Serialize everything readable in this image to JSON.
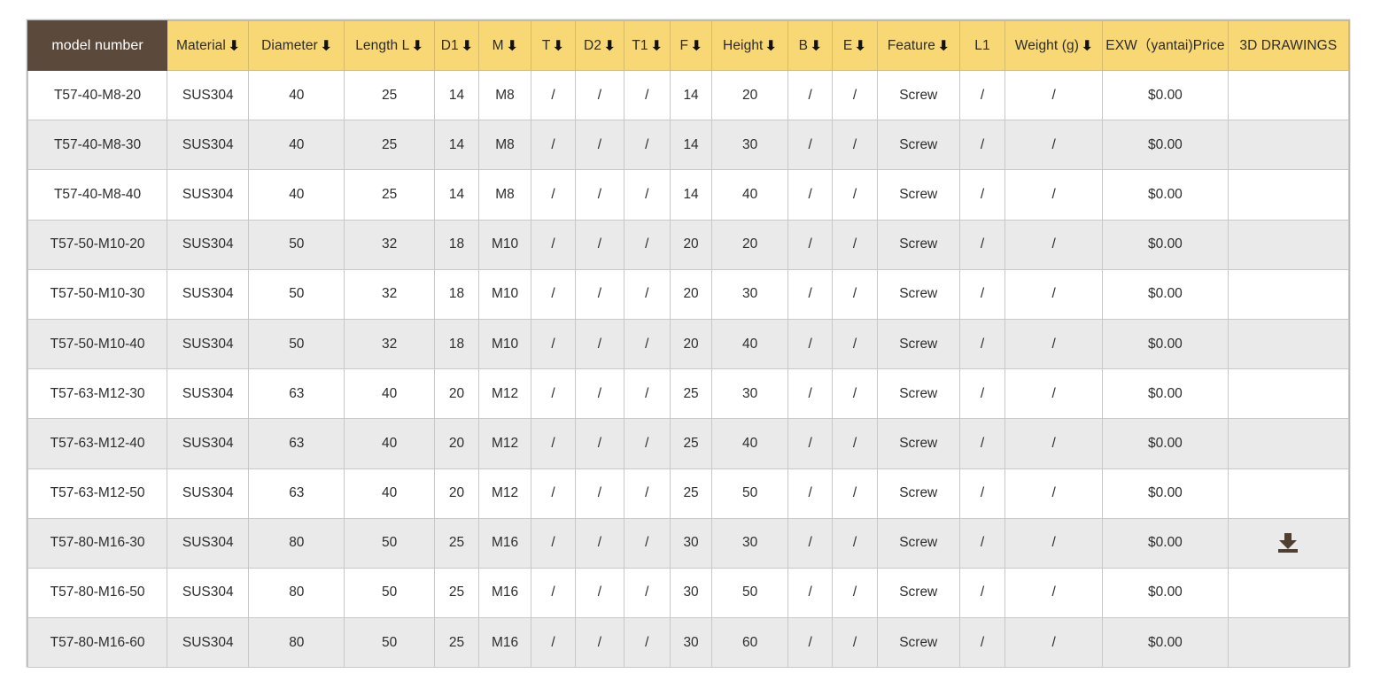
{
  "table": {
    "accent_header_bg": "#f8d775",
    "first_header_bg": "#5b4a3b",
    "stripe_bg": "#eaeaea",
    "icon_color": "#4e3f31",
    "sort_arrow_glyph": "⬇",
    "columns": [
      {
        "label": "model number",
        "sortable": false
      },
      {
        "label": "Material",
        "sortable": true
      },
      {
        "label": "Diameter",
        "sortable": true
      },
      {
        "label": "Length L",
        "sortable": true
      },
      {
        "label": "D1",
        "sortable": true
      },
      {
        "label": "M",
        "sortable": true
      },
      {
        "label": "T",
        "sortable": true
      },
      {
        "label": "D2",
        "sortable": true
      },
      {
        "label": "T1",
        "sortable": true
      },
      {
        "label": "F",
        "sortable": true
      },
      {
        "label": "Height",
        "sortable": true
      },
      {
        "label": "B",
        "sortable": true
      },
      {
        "label": "E",
        "sortable": true
      },
      {
        "label": "Feature",
        "sortable": true
      },
      {
        "label": "L1",
        "sortable": false
      },
      {
        "label": "Weight (g)",
        "sortable": true
      },
      {
        "label": "EXW（yantai)Price",
        "sortable": false
      },
      {
        "label": "3D DRAWINGS",
        "sortable": false
      }
    ],
    "rows": [
      {
        "cells": [
          "T57-40-M8-20",
          "SUS304",
          "40",
          "25",
          "14",
          "M8",
          "/",
          "/",
          "/",
          "14",
          "20",
          "/",
          "/",
          "Screw",
          "/",
          "/",
          "$0.00"
        ],
        "drawing": false
      },
      {
        "cells": [
          "T57-40-M8-30",
          "SUS304",
          "40",
          "25",
          "14",
          "M8",
          "/",
          "/",
          "/",
          "14",
          "30",
          "/",
          "/",
          "Screw",
          "/",
          "/",
          "$0.00"
        ],
        "drawing": false
      },
      {
        "cells": [
          "T57-40-M8-40",
          "SUS304",
          "40",
          "25",
          "14",
          "M8",
          "/",
          "/",
          "/",
          "14",
          "40",
          "/",
          "/",
          "Screw",
          "/",
          "/",
          "$0.00"
        ],
        "drawing": false
      },
      {
        "cells": [
          "T57-50-M10-20",
          "SUS304",
          "50",
          "32",
          "18",
          "M10",
          "/",
          "/",
          "/",
          "20",
          "20",
          "/",
          "/",
          "Screw",
          "/",
          "/",
          "$0.00"
        ],
        "drawing": false
      },
      {
        "cells": [
          "T57-50-M10-30",
          "SUS304",
          "50",
          "32",
          "18",
          "M10",
          "/",
          "/",
          "/",
          "20",
          "30",
          "/",
          "/",
          "Screw",
          "/",
          "/",
          "$0.00"
        ],
        "drawing": false
      },
      {
        "cells": [
          "T57-50-M10-40",
          "SUS304",
          "50",
          "32",
          "18",
          "M10",
          "/",
          "/",
          "/",
          "20",
          "40",
          "/",
          "/",
          "Screw",
          "/",
          "/",
          "$0.00"
        ],
        "drawing": false
      },
      {
        "cells": [
          "T57-63-M12-30",
          "SUS304",
          "63",
          "40",
          "20",
          "M12",
          "/",
          "/",
          "/",
          "25",
          "30",
          "/",
          "/",
          "Screw",
          "/",
          "/",
          "$0.00"
        ],
        "drawing": false
      },
      {
        "cells": [
          "T57-63-M12-40",
          "SUS304",
          "63",
          "40",
          "20",
          "M12",
          "/",
          "/",
          "/",
          "25",
          "40",
          "/",
          "/",
          "Screw",
          "/",
          "/",
          "$0.00"
        ],
        "drawing": false
      },
      {
        "cells": [
          "T57-63-M12-50",
          "SUS304",
          "63",
          "40",
          "20",
          "M12",
          "/",
          "/",
          "/",
          "25",
          "50",
          "/",
          "/",
          "Screw",
          "/",
          "/",
          "$0.00"
        ],
        "drawing": false
      },
      {
        "cells": [
          "T57-80-M16-30",
          "SUS304",
          "80",
          "50",
          "25",
          "M16",
          "/",
          "/",
          "/",
          "30",
          "30",
          "/",
          "/",
          "Screw",
          "/",
          "/",
          "$0.00"
        ],
        "drawing": true
      },
      {
        "cells": [
          "T57-80-M16-50",
          "SUS304",
          "80",
          "50",
          "25",
          "M16",
          "/",
          "/",
          "/",
          "30",
          "50",
          "/",
          "/",
          "Screw",
          "/",
          "/",
          "$0.00"
        ],
        "drawing": false
      },
      {
        "cells": [
          "T57-80-M16-60",
          "SUS304",
          "80",
          "50",
          "25",
          "M16",
          "/",
          "/",
          "/",
          "30",
          "60",
          "/",
          "/",
          "Screw",
          "/",
          "/",
          "$0.00"
        ],
        "drawing": false
      }
    ]
  }
}
